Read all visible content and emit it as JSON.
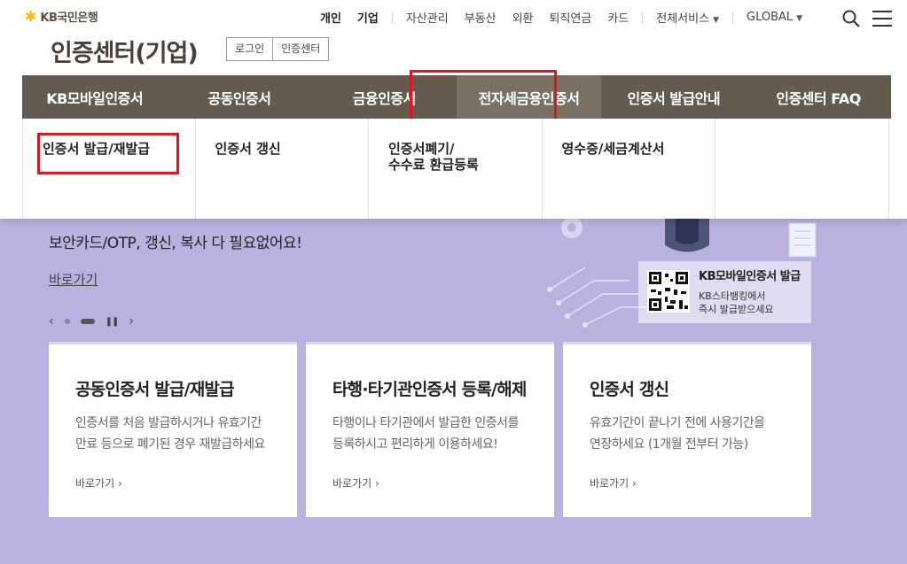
{
  "brand": {
    "name": "KB국민은행",
    "logo_icon": "kb-star-logo-icon",
    "accent": "#ffbc00"
  },
  "util_nav": {
    "items": [
      {
        "label": "개인",
        "bold": true
      },
      {
        "label": "기업",
        "bold": true
      },
      {
        "label": "자산관리"
      },
      {
        "label": "부동산"
      },
      {
        "label": "외환"
      },
      {
        "label": "퇴직연금"
      },
      {
        "label": "카드"
      }
    ],
    "all_services": "전체서비스",
    "global": "GLOBAL"
  },
  "page_title": "인증센터(기업)",
  "mini_tabs": [
    "로그인",
    "인증센터"
  ],
  "gnb": {
    "items": [
      "KB모바일인증서",
      "공동인증서",
      "금융인증서",
      "전자세금용인증서",
      "인증서 발급안내",
      "인증센터 FAQ"
    ],
    "active_index": 3,
    "bg_color": "#645a4e"
  },
  "dropdown": {
    "items": [
      "인증서 발급/재발급",
      "인증서 갱신",
      "인증서폐기/\n수수료 환급등록",
      "영수증/세금계산서"
    ]
  },
  "hero": {
    "subtitle": "보안카드/OTP, 갱신, 복사 다 필요없어요!",
    "link": "바로가기",
    "prev": "‹",
    "next": "›",
    "bg_color": "#b9b2e0",
    "qr_title": "KB모바일인증서 발급",
    "qr_desc_1": "KB스타뱅킹에서",
    "qr_desc_2": "즉시 발급받으세요"
  },
  "cards": [
    {
      "title": "공동인증서 발급/재발급",
      "desc1": "인증서를 처음 발급하시거나 유효기간",
      "desc2": "만료 등으로 폐기된 경우 재발급하세요",
      "link": "바로가기 ›"
    },
    {
      "title": "타행·타기관인증서 등록/해제",
      "desc1": "타행이나 타기관에서 발급한 인증서를",
      "desc2": "등록하시고 편리하게 이용하세요!",
      "link": "바로가기 ›"
    },
    {
      "title": "인증서 갱신",
      "desc1": "유효기간이 끝나기 전에 사용기간을",
      "desc2": "연장하세요 (1개월 전부터 가능)",
      "link": "바로가기 ›"
    }
  ]
}
